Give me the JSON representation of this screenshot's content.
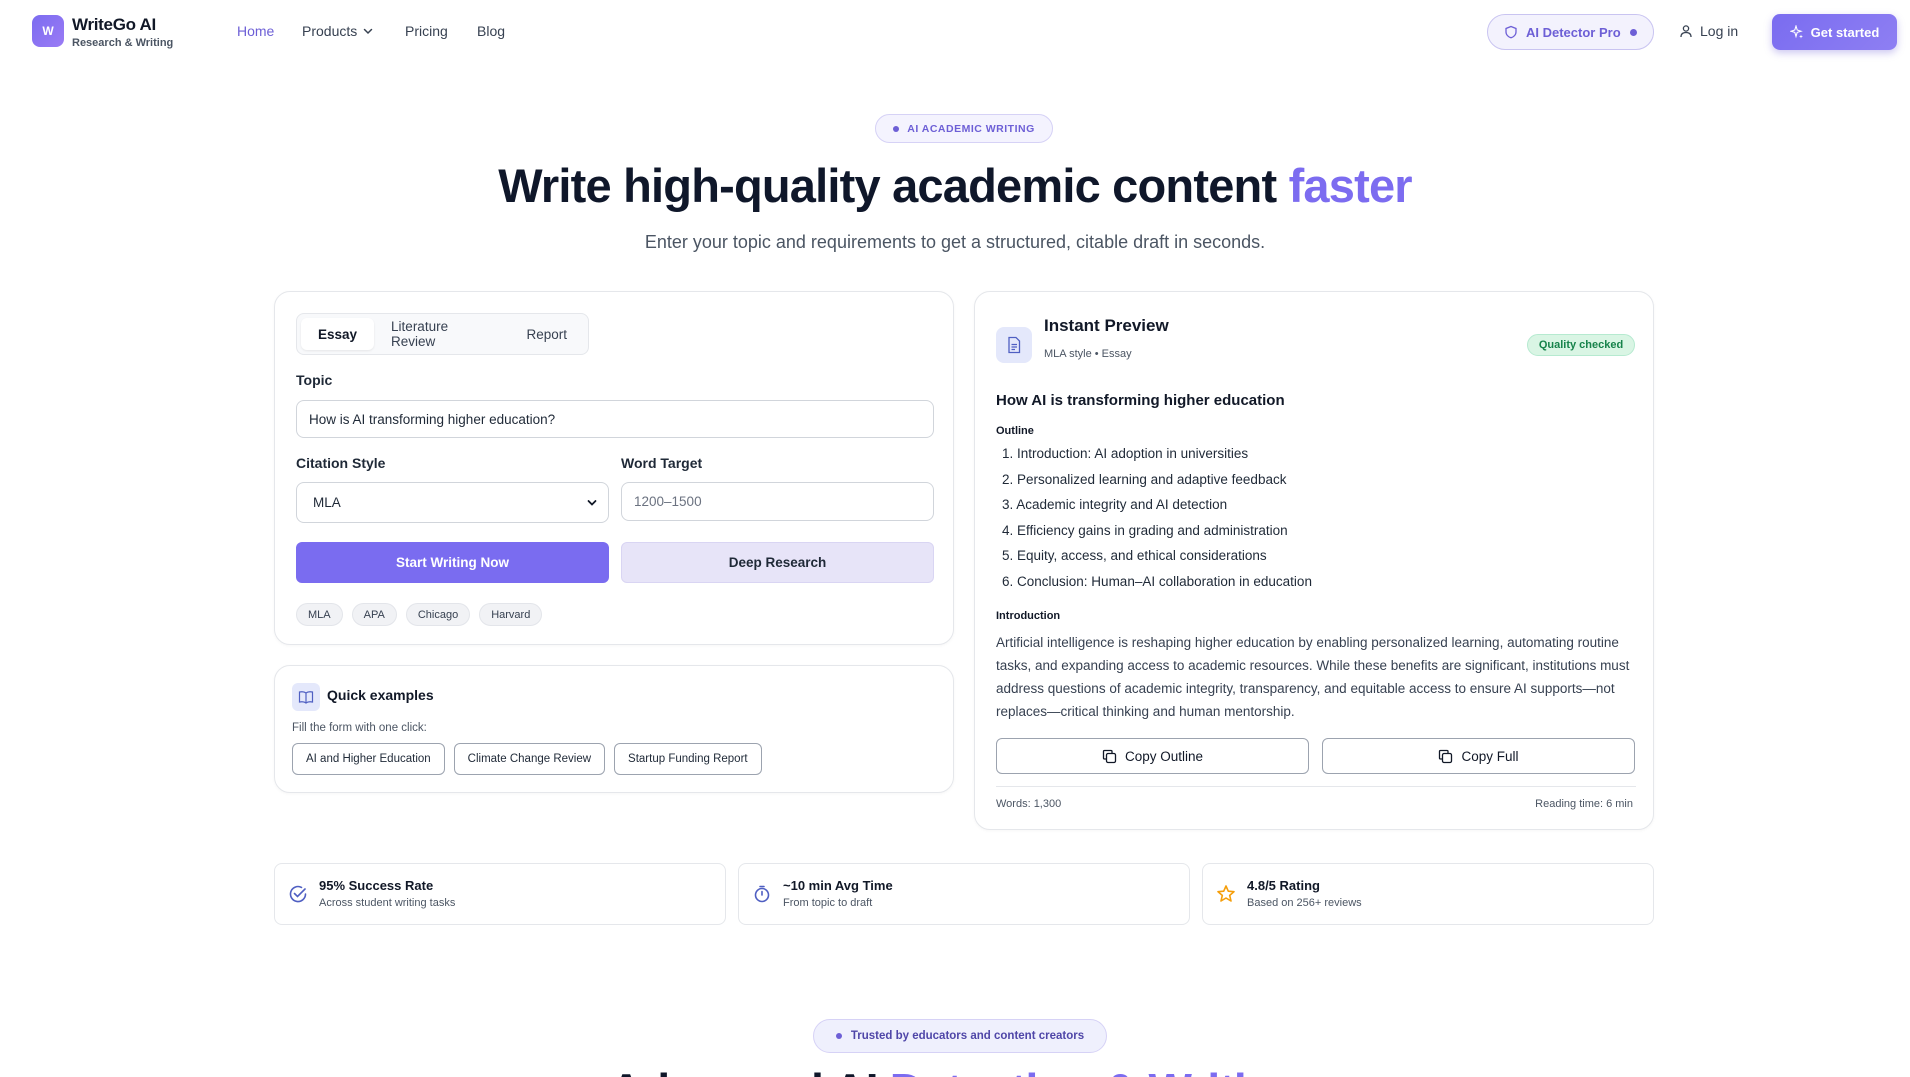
{
  "brand": {
    "name": "WriteGo AI",
    "tagline": "Research & Writing",
    "mark": "W"
  },
  "nav": {
    "links": [
      "Home",
      "Products",
      "Pricing",
      "Blog"
    ],
    "detector_pill": "AI Detector Pro",
    "login": "Log in",
    "cta": "Get started"
  },
  "hero": {
    "badge": "AI ACADEMIC WRITING",
    "title_main": "Write high-quality academic content ",
    "title_accent": "faster",
    "subtitle": "Enter your topic and requirements to get a structured, citable draft in seconds."
  },
  "form": {
    "tabs": [
      "Essay",
      "Literature Review",
      "Report"
    ],
    "active_tab": "Essay",
    "topic_label": "Topic",
    "topic_value": "How is AI transforming higher education?",
    "citation_label": "Citation Style",
    "citation_value": "MLA",
    "word_label": "Word Target",
    "word_placeholder": "1200–1500",
    "primary_button": "Start Writing Now",
    "secondary_button": "Deep Research",
    "styles": [
      "MLA",
      "APA",
      "Chicago",
      "Harvard"
    ]
  },
  "quick_examples": {
    "title": "Quick examples",
    "subtitle": "Fill the form with one click:",
    "items": [
      "AI and Higher Education",
      "Climate Change Review",
      "Startup Funding Report"
    ]
  },
  "preview": {
    "title": "Instant Preview",
    "meta": "MLA style • Essay",
    "badge": "Quality checked",
    "doc_title": "How AI is transforming higher education",
    "outline_label": "Outline",
    "outline": [
      "Introduction: AI adoption in universities",
      "Personalized learning and adaptive feedback",
      "Academic integrity and AI detection",
      "Efficiency gains in grading and administration",
      "Equity, access, and ethical considerations",
      "Conclusion: Human–AI collaboration in education"
    ],
    "intro_label": "Introduction",
    "intro_text": "Artificial intelligence is reshaping higher education by enabling personalized learning, automating routine tasks, and expanding access to academic resources. While these benefits are significant, institutions must address questions of academic integrity, transparency, and equitable access to ensure AI supports—not replaces—critical thinking and human mentorship.",
    "copy_outline": "Copy Outline",
    "copy_full": "Copy Full",
    "words": "Words: 1,300",
    "reading_time": "Reading time: 6 min"
  },
  "stats": [
    {
      "title": "95% Success Rate",
      "sub": "Across student writing tasks",
      "icon": "check-circle-icon"
    },
    {
      "title": "~10 min Avg Time",
      "sub": "From topic to draft",
      "icon": "stopwatch-icon"
    },
    {
      "title": "4.8/5 Rating",
      "sub": "Based on 256+ reviews",
      "icon": "star-icon"
    }
  ],
  "trusted": {
    "badge": "Trusted by educators and content creators",
    "title_main": "Advanced AI ",
    "title_accent": "Detection & Writing"
  },
  "colors": {
    "accent": "#7c6cf0",
    "primary": "#7a6cf0",
    "success": "#17834b",
    "star": "#f59e0b"
  }
}
